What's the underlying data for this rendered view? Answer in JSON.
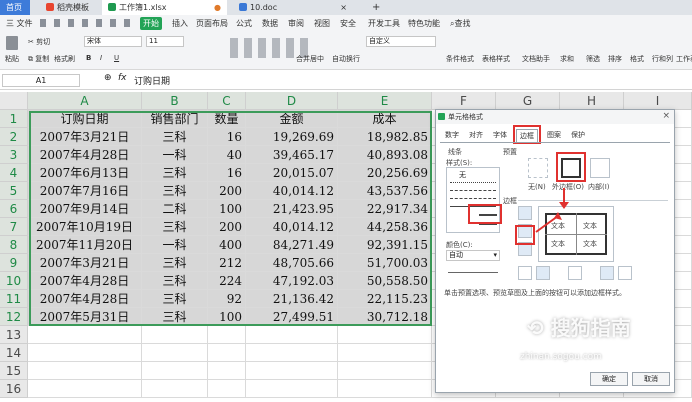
{
  "tabs": [
    {
      "label": "首页"
    },
    {
      "label": "稻壳模板"
    },
    {
      "label": "工作簿1.xlsx"
    },
    {
      "label": "10.doc"
    },
    {
      "label": "+"
    }
  ],
  "menu": {
    "file": "三 文件",
    "start": "开始",
    "items": [
      "插入",
      "页面布局",
      "公式",
      "数据",
      "审阅",
      "视图",
      "安全",
      "开发工具",
      "特色功能"
    ],
    "search": "查找"
  },
  "toolbar": {
    "paste": "粘贴",
    "cut": "剪切",
    "copy": "复制",
    "format_painter": "格式刷",
    "font": "宋体",
    "size": "11",
    "merge": "合并居中",
    "wrap": "自动换行",
    "numfmt": "自定义",
    "cond": "条件格式",
    "tablefmt": "表格样式",
    "doc_helper": "文档助手",
    "sum": "求和",
    "filter": "筛选",
    "sort": "排序",
    "format": "格式",
    "rowcol": "行和列",
    "ws": "工作表"
  },
  "formulabar": {
    "namebox": "A1",
    "fx": "fx",
    "value": "订购日期"
  },
  "columns": [
    "A",
    "B",
    "C",
    "D",
    "E",
    "F",
    "G",
    "H",
    "I"
  ],
  "rows": [
    "1",
    "2",
    "3",
    "4",
    "5",
    "6",
    "7",
    "8",
    "9",
    "10",
    "11",
    "12",
    "13",
    "14",
    "15",
    "16"
  ],
  "table": {
    "header": [
      "订购日期",
      "销售部门",
      "数量",
      "金额",
      "成本"
    ],
    "rows": [
      [
        "2007年3月21日",
        "三科",
        "16",
        "19,269.69",
        "18,982.85"
      ],
      [
        "2007年4月28日",
        "一科",
        "40",
        "39,465.17",
        "40,893.08"
      ],
      [
        "2007年6月13日",
        "三科",
        "16",
        "20,015.07",
        "20,256.69"
      ],
      [
        "2007年7月16日",
        "三科",
        "200",
        "40,014.12",
        "43,537.56"
      ],
      [
        "2007年9月14日",
        "二科",
        "100",
        "21,423.95",
        "22,917.34"
      ],
      [
        "2007年10月19日",
        "三科",
        "200",
        "40,014.12",
        "44,258.36"
      ],
      [
        "2007年11月20日",
        "一科",
        "400",
        "84,271.49",
        "92,391.15"
      ],
      [
        "2007年3月21日",
        "三科",
        "212",
        "48,705.66",
        "51,700.03"
      ],
      [
        "2007年4月28日",
        "三科",
        "224",
        "47,192.03",
        "50,558.50"
      ],
      [
        "2007年4月28日",
        "三科",
        "92",
        "21,136.42",
        "22,115.23"
      ],
      [
        "2007年5月31日",
        "三科",
        "100",
        "27,499.51",
        "30,712.18"
      ]
    ]
  },
  "dialog": {
    "title": "单元格格式",
    "tabs": [
      "数字",
      "对齐",
      "字体",
      "边框",
      "图案",
      "保护"
    ],
    "line_section": "线条",
    "style_label": "样式(S):",
    "none": "无",
    "preset_label": "预置",
    "preset_none": "无(N)",
    "preset_outline": "外边框(O)",
    "preset_inside": "内部(I)",
    "border_label": "边框",
    "text": "文本",
    "color_label": "颜色(C):",
    "color_value": "自动",
    "hint": "单击预置选项、预览草图及上面的按钮可以添加边框样式。",
    "ok": "确定",
    "cancel": "取消"
  },
  "watermark": {
    "brand": "搜狗指南",
    "url": "zhinan.sogou.com"
  },
  "colors": {
    "accent": "#1f8a46",
    "start_tab": "#22a356",
    "red": "#e0312f"
  }
}
